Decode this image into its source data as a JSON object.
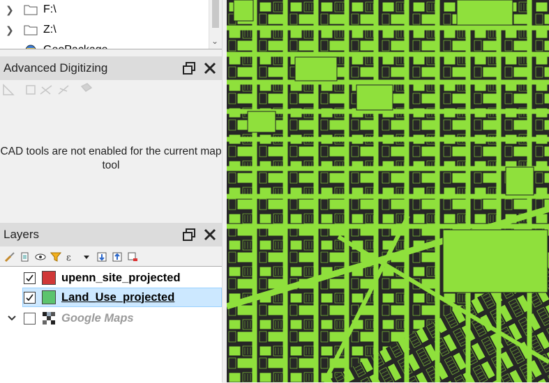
{
  "browser": {
    "items": [
      {
        "label": "F:\\",
        "icon": "folder-icon"
      },
      {
        "label": "Z:\\",
        "icon": "folder-icon"
      },
      {
        "label": "GeoPackage",
        "icon": "geopackage-icon"
      }
    ]
  },
  "advanced_digitizing": {
    "title": "Advanced Digitizing",
    "message": "CAD tools are not enabled for the current map tool"
  },
  "layers": {
    "title": "Layers",
    "items": [
      {
        "name": "upenn_site_projected",
        "checked": true,
        "color": "#d03838"
      },
      {
        "name": "Land_Use_projected",
        "checked": true,
        "color": "#5cc46e",
        "selected": true
      },
      {
        "name": "Google Maps",
        "checked": false
      }
    ]
  },
  "colors": {
    "map_background": "#262626",
    "land_use_fill": "#8fe03c"
  }
}
